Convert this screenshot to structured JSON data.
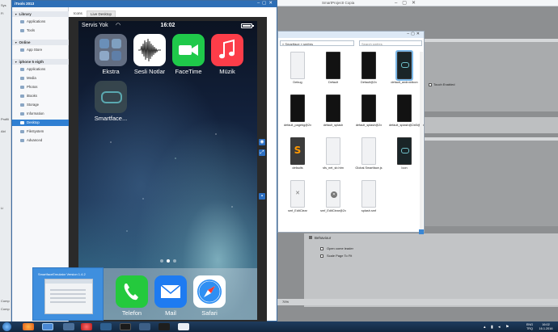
{
  "background_ide": {
    "left_strip_labels": [
      "Sys",
      "Fi",
      "Profili",
      "Abl",
      "Li",
      "Comp",
      "Comp"
    ],
    "title": "SmartProjectI Copia",
    "touch_enabled_label": "Touch Enabled",
    "behaviour": {
      "title": "Behaviour",
      "options": [
        "Open come leader",
        "Scale Page To Fit"
      ]
    },
    "status": "70%"
  },
  "explorer": {
    "address": "« Smartface » smfres",
    "search_placeholder": "Search smfres",
    "files": [
      {
        "name": "Debug",
        "icon": "doc"
      },
      {
        "name": "Default",
        "icon": "dark"
      },
      {
        "name": "Default@2x",
        "icon": "dark"
      },
      {
        "name": "default_androidicon",
        "icon": "dark-logo"
      },
      {
        "name": "default_pagebg@2x",
        "icon": "dark"
      },
      {
        "name": "default_splash",
        "icon": "dark"
      },
      {
        "name": "default_splash@2x",
        "icon": "dark"
      },
      {
        "name": "default_splash@2xi5@2x",
        "icon": "dark"
      },
      {
        "name": "defaults",
        "icon": "sublime"
      },
      {
        "name": "sfs_net_sb.htm",
        "icon": "doc"
      },
      {
        "name": "Global.Smartface.js",
        "icon": "doc"
      },
      {
        "name": "Icon",
        "icon": "dark-logo"
      },
      {
        "name": "smf_EditClear",
        "icon": "x"
      },
      {
        "name": "smf_EditClear@2x",
        "icon": "x-circle"
      },
      {
        "name": "splash.smf",
        "icon": "doc"
      }
    ]
  },
  "window": {
    "title": "iTools 2013",
    "tabs": [
      "Icons",
      "Live Desktop"
    ],
    "sidebar": {
      "sections": [
        {
          "title": "Library",
          "items": [
            "Applications",
            "Tools"
          ]
        },
        {
          "title": "Online",
          "items": [
            "App Store"
          ]
        },
        {
          "title": "iphone 5 eigth",
          "items": [
            "Applications",
            "Media",
            "Photos",
            "iBooks",
            "Storage",
            "Information",
            "Desktop",
            "FileSystem",
            "Advanced"
          ]
        }
      ],
      "active_item": "Desktop"
    }
  },
  "phone": {
    "carrier": "Servis Yok",
    "time": "16:02",
    "apps": [
      {
        "label": "Ekstra",
        "icon": "folder-icon"
      },
      {
        "label": "Sesli Notlar",
        "icon": "voice-memo-icon"
      },
      {
        "label": "FaceTime",
        "icon": "facetime-icon"
      },
      {
        "label": "Müzik",
        "icon": "music-icon"
      },
      {
        "label": "Smartface...",
        "icon": "smartface-icon"
      }
    ],
    "dock": [
      {
        "label": "Telefon",
        "icon": "phone-icon"
      },
      {
        "label": "Mail",
        "icon": "mail-icon"
      },
      {
        "label": "Safari",
        "icon": "safari-icon"
      }
    ],
    "pages": 3,
    "current_page": 2
  },
  "thumbnail": {
    "caption": "SmartfaceEmulator Version 1.4.2"
  },
  "taskbar": {
    "lang": "ENG\nTRQ",
    "clock": "16:02\n16.1.2016"
  }
}
